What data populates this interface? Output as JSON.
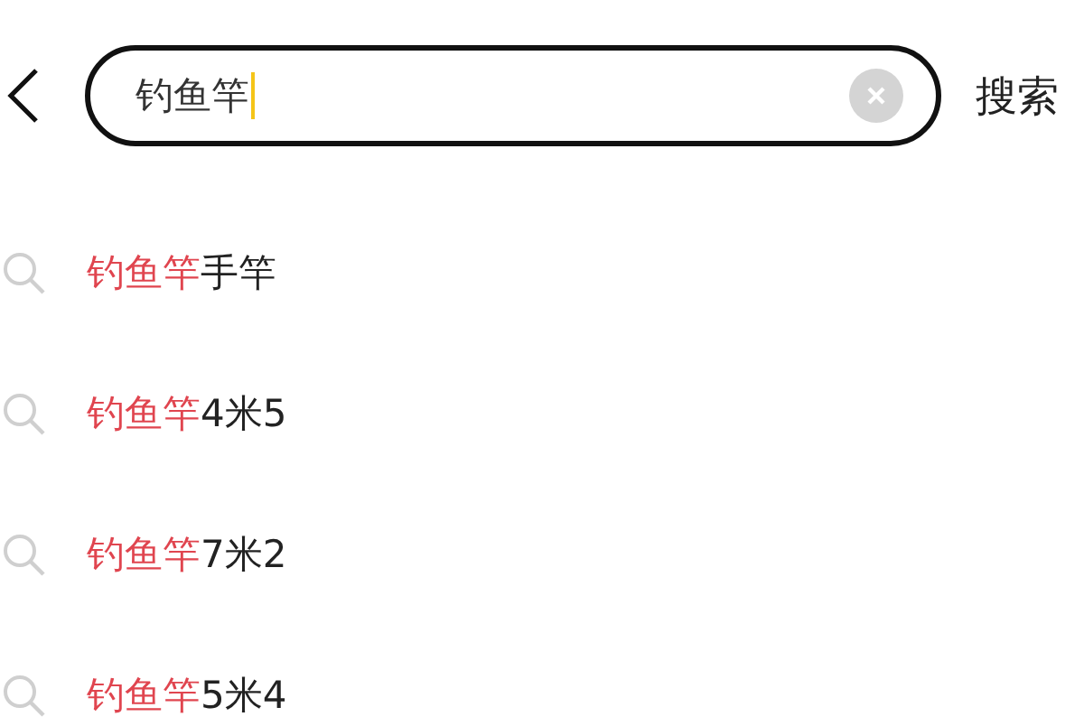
{
  "search": {
    "value": "钓鱼竿",
    "button": "搜索"
  },
  "suggestions": [
    {
      "highlight": "钓鱼竿",
      "rest": "手竿"
    },
    {
      "highlight": "钓鱼竿",
      "rest": "4米5"
    },
    {
      "highlight": "钓鱼竿",
      "rest": "7米2"
    },
    {
      "highlight": "钓鱼竿",
      "rest": "5米4"
    }
  ]
}
